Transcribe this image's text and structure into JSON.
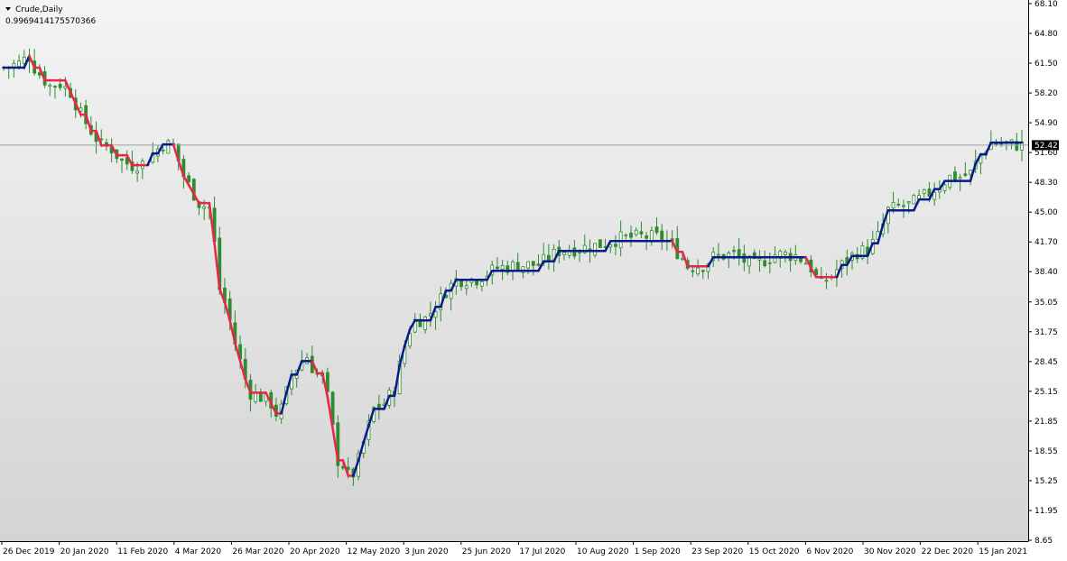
{
  "header": {
    "title": "Crude,Daily",
    "value": "0.9969414175570366"
  },
  "chart_data": {
    "type": "candlestick",
    "symbol": "Crude",
    "timeframe": "Daily",
    "ylim": [
      8.65,
      68.1
    ],
    "y_ticks": [
      "68.10",
      "64.80",
      "61.50",
      "58.20",
      "54.90",
      "51.60",
      "48.30",
      "45.00",
      "41.70",
      "38.40",
      "35.05",
      "31.75",
      "28.45",
      "25.15",
      "21.85",
      "18.55",
      "15.25",
      "11.95",
      "8.65"
    ],
    "x_labels": [
      "26 Dec 2019",
      "20 Jan 2020",
      "11 Feb 2020",
      "4 Mar 2020",
      "26 Mar 2020",
      "20 Apr 2020",
      "12 May 2020",
      "3 Jun 2020",
      "25 Jun 2020",
      "17 Jul 2020",
      "10 Aug 2020",
      "1 Sep 2020",
      "23 Sep 2020",
      "15 Oct 2020",
      "6 Nov 2020",
      "30 Nov 2020",
      "22 Dec 2020",
      "15 Jan 2021"
    ],
    "last_price": 52.42,
    "last_price_label": "52.42",
    "colors": {
      "background_top": "#f4f4f4",
      "background_bottom": "#d4d4d4",
      "candle": "#2e8b2e",
      "line_up": "#0a1a8c",
      "line_down": "#e8264a",
      "price_line": "#a0a0a0"
    },
    "close_path": [
      [
        0,
        61.0
      ],
      [
        3,
        61.5
      ],
      [
        5,
        62.3
      ],
      [
        6,
        61.0
      ],
      [
        8,
        59.6
      ],
      [
        9,
        59.0
      ],
      [
        11,
        59.2
      ],
      [
        13,
        58.3
      ],
      [
        15,
        55.8
      ],
      [
        17,
        54.0
      ],
      [
        19,
        52.4
      ],
      [
        21,
        52.0
      ],
      [
        23,
        50.6
      ],
      [
        25,
        50.2
      ],
      [
        27,
        50.4
      ],
      [
        28,
        50.8
      ],
      [
        29,
        51.5
      ],
      [
        31,
        52.5
      ],
      [
        33,
        52.4
      ],
      [
        35,
        49.0
      ],
      [
        37,
        47.0
      ],
      [
        38,
        46.0
      ],
      [
        40,
        45.4
      ],
      [
        41,
        41.5
      ],
      [
        42,
        36.5
      ],
      [
        43,
        35.0
      ],
      [
        44,
        33.0
      ],
      [
        45,
        30.5
      ],
      [
        47,
        26.5
      ],
      [
        48,
        25.0
      ],
      [
        50,
        24.5
      ],
      [
        52,
        23.8
      ],
      [
        53,
        22.7
      ],
      [
        54,
        23.2
      ],
      [
        55,
        25.0
      ],
      [
        56,
        27.0
      ],
      [
        58,
        28.5
      ],
      [
        59,
        29.0
      ],
      [
        60,
        27.8
      ],
      [
        62,
        26.5
      ],
      [
        63,
        24.5
      ],
      [
        64,
        21.0
      ],
      [
        65,
        17.5
      ],
      [
        66,
        17.0
      ],
      [
        67,
        15.8
      ],
      [
        68,
        16.0
      ],
      [
        69,
        17.5
      ],
      [
        70,
        19.5
      ],
      [
        72,
        23.2
      ],
      [
        74,
        23.8
      ],
      [
        76,
        25.5
      ],
      [
        77,
        28.0
      ],
      [
        78,
        30.2
      ],
      [
        79,
        32.0
      ],
      [
        80,
        33.0
      ],
      [
        82,
        33.2
      ],
      [
        84,
        34.5
      ],
      [
        86,
        36.3
      ],
      [
        88,
        37.5
      ],
      [
        92,
        37.6
      ],
      [
        94,
        38.2
      ],
      [
        96,
        38.8
      ],
      [
        100,
        39.1
      ],
      [
        104,
        39.2
      ],
      [
        106,
        39.9
      ],
      [
        108,
        40.7
      ],
      [
        112,
        41.0
      ],
      [
        116,
        41.4
      ],
      [
        118,
        41.8
      ],
      [
        120,
        42.1
      ],
      [
        124,
        42.3
      ],
      [
        128,
        42.2
      ],
      [
        130,
        41.3
      ],
      [
        132,
        39.9
      ],
      [
        133,
        39.0
      ],
      [
        136,
        39.1
      ],
      [
        138,
        40.0
      ],
      [
        140,
        40.2
      ],
      [
        142,
        40.3
      ],
      [
        144,
        39.6
      ],
      [
        146,
        39.1
      ],
      [
        148,
        39.7
      ],
      [
        150,
        40.3
      ],
      [
        152,
        40.3
      ],
      [
        154,
        40.2
      ],
      [
        156,
        39.5
      ],
      [
        157,
        38.8
      ],
      [
        158,
        37.8
      ],
      [
        159,
        37.0
      ],
      [
        160,
        37.5
      ],
      [
        161,
        38.0
      ],
      [
        162,
        38.6
      ],
      [
        164,
        39.7
      ],
      [
        166,
        40.6
      ],
      [
        168,
        40.8
      ],
      [
        170,
        42.3
      ],
      [
        171,
        43.6
      ],
      [
        172,
        45.2
      ],
      [
        174,
        45.6
      ],
      [
        176,
        45.8
      ],
      [
        178,
        46.4
      ],
      [
        180,
        47.1
      ],
      [
        182,
        48.0
      ],
      [
        184,
        48.9
      ],
      [
        186,
        48.9
      ],
      [
        188,
        49.3
      ],
      [
        190,
        51.4
      ],
      [
        192,
        52.7
      ],
      [
        194,
        52.5
      ],
      [
        196,
        52.5
      ],
      [
        198,
        52.4
      ]
    ]
  }
}
